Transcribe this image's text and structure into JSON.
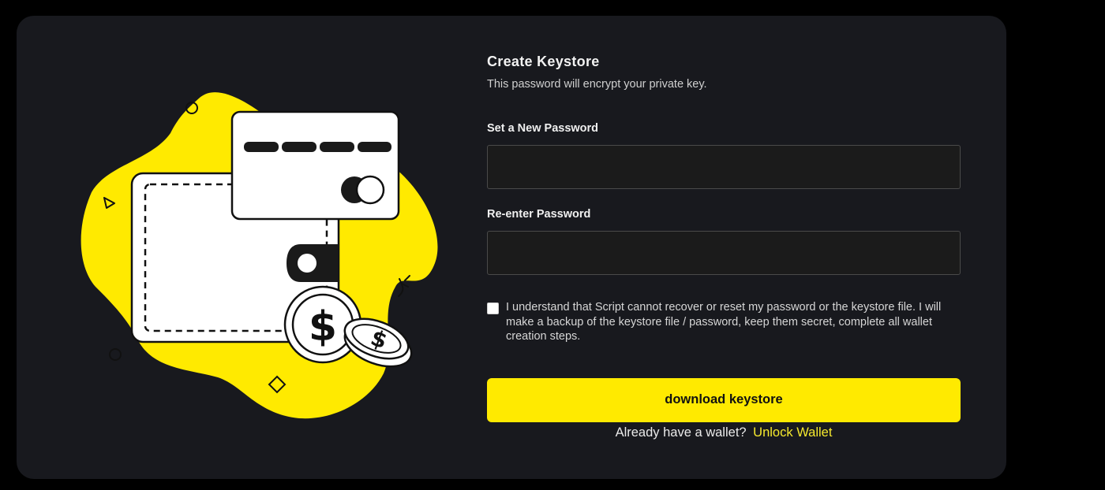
{
  "form": {
    "title": "Create Keystore",
    "subtitle": "This password will encrypt your private key.",
    "new_password_label": "Set a New Password",
    "new_password_value": "",
    "confirm_password_label": "Re-enter Password",
    "confirm_password_value": "",
    "terms_checked": false,
    "terms_text": "I understand that Script cannot recover or reset my password or the keystore file. I will make a backup of the keystore file / password, keep them secret, complete all wallet creation steps.",
    "download_button_label": "download keystore",
    "footer_prompt": "Already have a wallet?",
    "footer_link": "Unlock Wallet"
  },
  "illustration": {
    "description_icon": "wallet-card-coins-icon"
  },
  "colors": {
    "background": "#000000",
    "card": "#18191e",
    "accent": "#ffea00",
    "link": "#f5e92e",
    "input_bg": "#1b1b1b",
    "input_border": "#4a4a4a"
  }
}
